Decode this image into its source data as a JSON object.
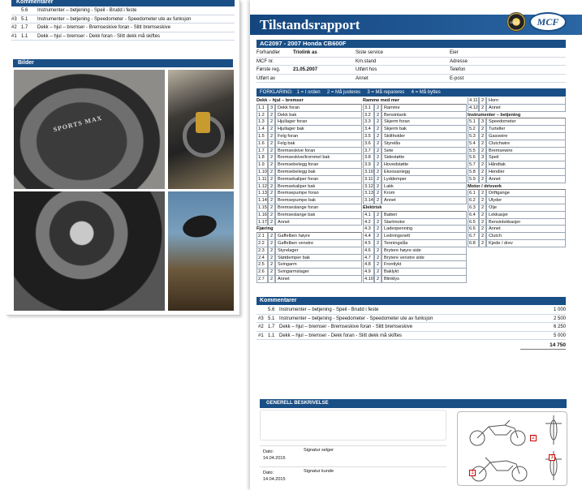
{
  "left_page": {
    "comments_header": "Kommentarer",
    "comments": [
      {
        "tag": "",
        "code": "5.6",
        "text": "Instrumenter – betjening  -  Speil  -  Brudd i feste"
      },
      {
        "tag": "#3",
        "code": "5.1",
        "text": "Instrumenter – betjening  -  Speedometer  -  Speedometer ute av funksjon"
      },
      {
        "tag": "#2",
        "code": "1.7",
        "text": "Dekk – hjul – bremser  -  Bremseskive foran  -  Slitt bremseskive"
      },
      {
        "tag": "#1",
        "code": "1.1",
        "text": "Dekk – hjul – bremser  -  Dekk foran  -  Slitt dekk må skiftes"
      }
    ],
    "pictures_header": "Bilder",
    "tire_text": "SPORTS MAX"
  },
  "report": {
    "title": "Tilstandsrapport",
    "badge_small": "GOLD",
    "badge_logo": "MCF",
    "vehicle": "AC2097 - 2007 Honda CB600F",
    "info_rows": [
      {
        "l1": "Forhandler",
        "v1": "Triolink as",
        "l2": "Siste service",
        "v2": "",
        "l3": "Eier",
        "v3": ""
      },
      {
        "l1": "MCF nr.",
        "v1": "",
        "l2": "Km.stand",
        "v2": "",
        "l3": "Adresse",
        "v3": ""
      },
      {
        "l1": "Første reg.",
        "v1": "21.05.2007",
        "l2": "Utført hos",
        "v2": "",
        "l3": "Telefon",
        "v3": ""
      },
      {
        "l1": "Utført av",
        "v1": "",
        "l2": "Annet",
        "v2": "",
        "l3": "E-post",
        "v3": ""
      }
    ],
    "legend": "FORKLARING:   1 = I orden     2 = Må justeres     3 = Må repareres     4 = Må byttes",
    "columns": [
      [
        {
          "h": "Dekk – hjul – bremser"
        },
        {
          "n": "1.1",
          "v": "3",
          "d": "Dekk foran"
        },
        {
          "n": "1.2",
          "v": "2",
          "d": "Dekk bak"
        },
        {
          "n": "1.3",
          "v": "2",
          "d": "Hjullager foran"
        },
        {
          "n": "1.4",
          "v": "2",
          "d": "Hjullager bak"
        },
        {
          "n": "1.5",
          "v": "2",
          "d": "Felg foran"
        },
        {
          "n": "1.6",
          "v": "2",
          "d": "Felg bak"
        },
        {
          "n": "1.7",
          "v": "2",
          "d": "Bremseskive foran"
        },
        {
          "n": "1.8",
          "v": "2",
          "d": "Bremseskive/trommel bak"
        },
        {
          "n": "1.9",
          "v": "2",
          "d": "Bremsebelegg foran"
        },
        {
          "n": "1.10",
          "v": "2",
          "d": "Bremsebelegg bak"
        },
        {
          "n": "1.11",
          "v": "2",
          "d": "Bremsekaliper foran"
        },
        {
          "n": "1.12",
          "v": "2",
          "d": "Bremsekaliper bak"
        },
        {
          "n": "1.13",
          "v": "2",
          "d": "Bremsepumpe foran"
        },
        {
          "n": "1.14",
          "v": "2",
          "d": "Bremsepumpe bak"
        },
        {
          "n": "1.15",
          "v": "2",
          "d": "Bremseslange foran"
        },
        {
          "n": "1.16",
          "v": "2",
          "d": "Bremseslange bak"
        },
        {
          "n": "1.17",
          "v": "2",
          "d": "Annet"
        },
        {
          "h": "Fjæring"
        },
        {
          "n": "2.1",
          "v": "2",
          "d": "Gaffelben høyre"
        },
        {
          "n": "2.2",
          "v": "2",
          "d": "Gaffelben venstre"
        },
        {
          "n": "2.3",
          "v": "2",
          "d": "Styrelager"
        },
        {
          "n": "2.4",
          "v": "2",
          "d": "Støtdemper bak"
        },
        {
          "n": "2.5",
          "v": "2",
          "d": "Svingarm"
        },
        {
          "n": "2.6",
          "v": "2",
          "d": "Svingarmslager"
        },
        {
          "n": "2.7",
          "v": "2",
          "d": "Annet"
        }
      ],
      [
        {
          "h": "Ramme med mer"
        },
        {
          "n": "3.1",
          "v": "2",
          "d": "Ramme"
        },
        {
          "n": "3.2",
          "v": "2",
          "d": "Bensintank"
        },
        {
          "n": "3.3",
          "v": "2",
          "d": "Skjerm foran"
        },
        {
          "n": "3.4",
          "v": "2",
          "d": "Skjerm bak"
        },
        {
          "n": "3.5",
          "v": "2",
          "d": "Skiltholder"
        },
        {
          "n": "3.6",
          "v": "2",
          "d": "Styrelås"
        },
        {
          "n": "3.7",
          "v": "2",
          "d": "Sete"
        },
        {
          "n": "3.8",
          "v": "2",
          "d": "Sidestøtte"
        },
        {
          "n": "3.9",
          "v": "2",
          "d": "Hovedstøtte"
        },
        {
          "n": "3.10",
          "v": "2",
          "d": "Eksosanlegg"
        },
        {
          "n": "3.11",
          "v": "2",
          "d": "Lyddemper"
        },
        {
          "n": "3.12",
          "v": "2",
          "d": "Lakk"
        },
        {
          "n": "3.13",
          "v": "2",
          "d": "Krom"
        },
        {
          "n": "3.14",
          "v": "2",
          "d": "Annet"
        },
        {
          "h": "Elektrisk"
        },
        {
          "n": "4.1",
          "v": "2",
          "d": "Batteri"
        },
        {
          "n": "4.2",
          "v": "2",
          "d": "Startmotor"
        },
        {
          "n": "4.3",
          "v": "2",
          "d": "Ladespenning"
        },
        {
          "n": "4.4",
          "v": "2",
          "d": "Ledningsnett"
        },
        {
          "n": "4.5",
          "v": "2",
          "d": "Tenningslås"
        },
        {
          "n": "4.6",
          "v": "2",
          "d": "Brytere høyre side"
        },
        {
          "n": "4.7",
          "v": "2",
          "d": "Brytere venstre side"
        },
        {
          "n": "4.8",
          "v": "2",
          "d": "Frontlykt"
        },
        {
          "n": "4.9",
          "v": "2",
          "d": "Baklykt"
        },
        {
          "n": "4.10",
          "v": "2",
          "d": "Blinklys"
        }
      ],
      [
        {
          "n": "4.11",
          "v": "2",
          "d": "Horn"
        },
        {
          "n": "4.12",
          "v": "2",
          "d": "Annet"
        },
        {
          "h": "Instrumenter – betjening"
        },
        {
          "n": "5.1",
          "v": "3",
          "d": "Speedometer"
        },
        {
          "n": "5.2",
          "v": "2",
          "d": "Turteller"
        },
        {
          "n": "5.3",
          "v": "2",
          "d": "Gasswire"
        },
        {
          "n": "5.4",
          "v": "2",
          "d": "Clutchwire"
        },
        {
          "n": "5.5",
          "v": "2",
          "d": "Bremsewire"
        },
        {
          "n": "5.6",
          "v": "3",
          "d": "Speil"
        },
        {
          "n": "5.7",
          "v": "2",
          "d": "Håndtak"
        },
        {
          "n": "5.8",
          "v": "2",
          "d": "Hendler"
        },
        {
          "n": "5.9",
          "v": "2",
          "d": "Annet"
        },
        {
          "h": "Motor / drivverk"
        },
        {
          "n": "6.1",
          "v": "2",
          "d": "Driftgange"
        },
        {
          "n": "6.2",
          "v": "2",
          "d": "Ulyder"
        },
        {
          "n": "6.3",
          "v": "2",
          "d": "Olje"
        },
        {
          "n": "6.4",
          "v": "2",
          "d": "Lekkasjer"
        },
        {
          "n": "6.5",
          "v": "2",
          "d": "Bensinlekkasjer"
        },
        {
          "n": "6.6",
          "v": "2",
          "d": "Annet"
        },
        {
          "n": "6.7",
          "v": "2",
          "d": "Clutch"
        },
        {
          "n": "6.8",
          "v": "2",
          "d": "Kjede / drev"
        }
      ]
    ],
    "comments_header": "Kommentarer",
    "comments": [
      {
        "tag": "",
        "code": "5.6",
        "text": "Instrumenter – betjening  -  Speil  -  Brudd i feste",
        "amount": "1 000"
      },
      {
        "tag": "#3",
        "code": "5.1",
        "text": "Instrumenter – betjening  -  Speedometer  -  Speedometer ute av funksjon",
        "amount": "2 500"
      },
      {
        "tag": "#2",
        "code": "1.7",
        "text": "Dekk – hjul – bremser  -  Bremseskive foran  -  Slitt bremseskive",
        "amount": "6 250"
      },
      {
        "tag": "#1",
        "code": "1.1",
        "text": "Dekk – hjul – bremser  -  Dekk foran  -  Slitt dekk må skiftes",
        "amount": "5 000"
      }
    ],
    "total": "14 750",
    "general_header": "GENERELL BESKRIVELSE",
    "signatures": [
      {
        "date_label": "Dato:",
        "date": "14.04.2015",
        "sign_label": "Signatur selger"
      },
      {
        "date_label": "Dato:",
        "date": "14.04.2015",
        "sign_label": "Signatur kunde"
      }
    ],
    "diagram_markers": [
      "1",
      "2",
      "3"
    ]
  },
  "colors": {
    "header_blue": "#1a4f86",
    "marker_red": "#cc0000"
  }
}
